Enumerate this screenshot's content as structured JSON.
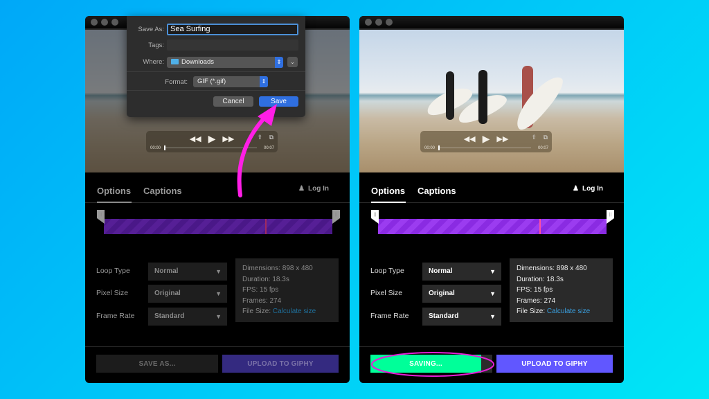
{
  "windows": [
    {
      "id": "left",
      "tabs": [
        "Options",
        "Captions"
      ],
      "login_label": "Log In",
      "player": {
        "time_start": "00:00",
        "time_end": "00:07"
      },
      "settings": [
        {
          "label": "Loop Type",
          "value": "Normal"
        },
        {
          "label": "Pixel Size",
          "value": "Original"
        },
        {
          "label": "Frame Rate",
          "value": "Standard"
        }
      ],
      "info": {
        "dimensions": "Dimensions: 898 x 480",
        "duration": "Duration: 18.3s",
        "fps": "FPS: 15 fps",
        "frames": "Frames: 274",
        "file_size_label": "File Size:",
        "file_size_link": "Calculate size"
      },
      "buttons": {
        "save": "SAVE AS...",
        "upload": "UPLOAD TO GIPHY"
      }
    },
    {
      "id": "right",
      "tabs": [
        "Options",
        "Captions"
      ],
      "login_label": "Log In",
      "player": {
        "time_start": "00:00",
        "time_end": "00:07"
      },
      "settings": [
        {
          "label": "Loop Type",
          "value": "Normal"
        },
        {
          "label": "Pixel Size",
          "value": "Original"
        },
        {
          "label": "Frame Rate",
          "value": "Standard"
        }
      ],
      "info": {
        "dimensions": "Dimensions: 898 x 480",
        "duration": "Duration: 18.3s",
        "fps": "FPS: 15 fps",
        "frames": "Frames: 274",
        "file_size_label": "File Size:",
        "file_size_link": "Calculate size"
      },
      "buttons": {
        "save": "SAVING...",
        "upload": "UPLOAD TO GIPHY"
      }
    }
  ],
  "save_dialog": {
    "save_as_label": "Save As:",
    "save_as_value": "Sea Surfing",
    "tags_label": "Tags:",
    "where_label": "Where:",
    "where_value": "Downloads",
    "format_label": "Format:",
    "format_value": "GIF (*.gif)",
    "cancel": "Cancel",
    "save": "Save"
  },
  "icons": {
    "rewind": "◀◀",
    "play": "▶",
    "forward": "▶▶",
    "share": "⇧",
    "pip": "⧉",
    "user": "👤",
    "caret": "▼",
    "stepper": "⇕",
    "expand": "⌄",
    "grip": "||"
  },
  "colors": {
    "accent_green": "#00ff99",
    "accent_purple": "#6157ff",
    "trim_purple": "#8a2be2",
    "link_blue": "#3aa0e0",
    "annotation_magenta": "#ff1ee6"
  }
}
